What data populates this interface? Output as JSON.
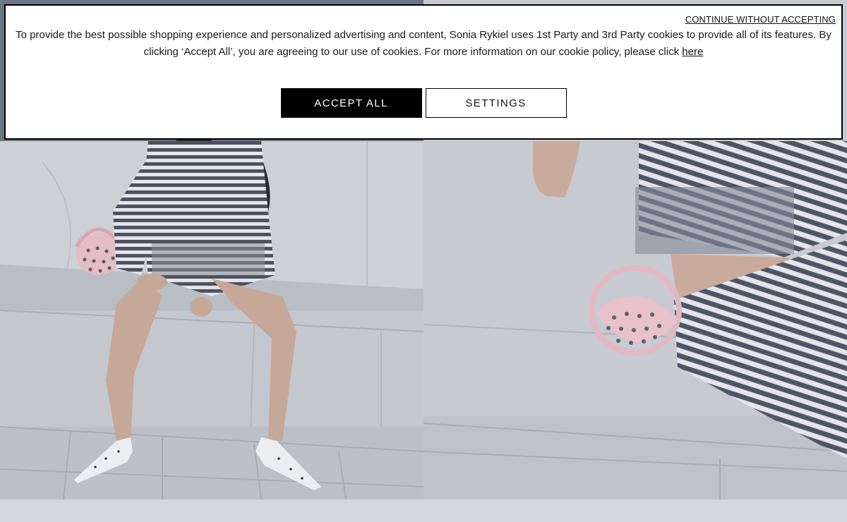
{
  "cookie_banner": {
    "skip_label": "CONTINUE WITHOUT ACCEPTING",
    "message": "To provide the best possible shopping experience and personalized advertising and content, Sonia Rykiel uses 1st Party and 3rd Party cookies to provide all of its features. By clicking ‘Accept All’, you are agreeing to our use of cookies. For more information on our cookie policy, please click",
    "policy_link_label": "here",
    "accept_label": "ACCEPT ALL",
    "settings_label": "SETTINGS"
  },
  "colors": {
    "banner_bg": "#ffffff",
    "accept_bg": "#000000",
    "accept_text": "#ffffff",
    "page_bg": "#d2d8e2"
  }
}
